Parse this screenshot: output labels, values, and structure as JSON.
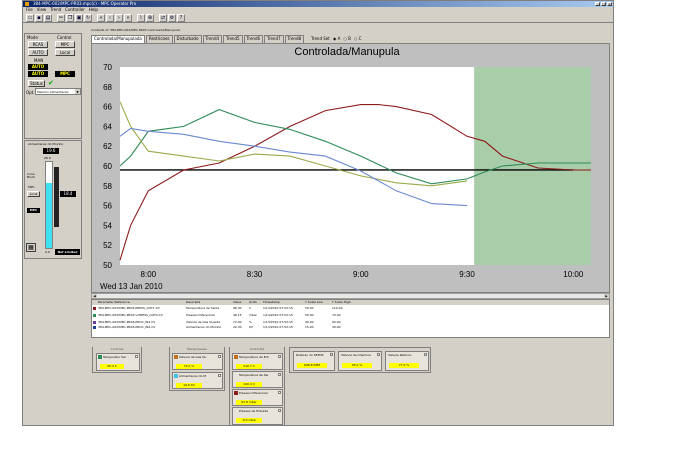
{
  "window": {
    "title": "384-MPC-002/MPC-PR03.mpc(c) - MPC Operator Pro"
  },
  "menu": [
    "File",
    "View",
    "Trend",
    "Controller",
    "Help"
  ],
  "toolbar": {
    "icons": [
      "open-icon",
      "save-icon",
      "print-icon",
      "cut-icon",
      "copy-icon",
      "paste-icon",
      "refresh-icon",
      "first-icon",
      "prev-icon",
      "next-icon",
      "last-icon",
      "trend-icon",
      "zoom-icon",
      "connect-icon",
      "gear-icon",
      "help-icon"
    ]
  },
  "left": {
    "mode_label": "Mode",
    "control_label": "Control",
    "rcas": "RCAS",
    "auto": "AUTO",
    "man": "MAN",
    "mpc_btn": "MPC",
    "local_btn": "Local",
    "mode_state1": "AUTO",
    "mode_state2": "AUTO",
    "mpc_state": "MPC",
    "status_label": "Status",
    "opt_label": "Opt.",
    "opt_value": "Maximo Alimentacao",
    "feed_title": "Alimentacao do Moinho",
    "feed_value": "19.6",
    "scale_top": "28.0",
    "scale_bottom": "0.0",
    "bar_value": "18.4",
    "cons_block": "Cons. Block",
    "mpc_small": "MPC",
    "local_small": "Local",
    "mpc_state2": "MPC",
    "not_limited": "Not Limited"
  },
  "main": {
    "path": "Contents of '384-MPC-002/MPC-PR03 Controlada/Manupula'",
    "tabs": [
      "Controlada/Manupulada",
      "Restricoes",
      "Disturbado",
      "Trend4",
      "Trend5",
      "Trend6",
      "Trend7",
      "Trend8"
    ],
    "trendset_label": "Trend Set",
    "trendset_options": [
      "A",
      "B",
      "C"
    ]
  },
  "chart_data": {
    "type": "line",
    "title": "Controlada/Manupula",
    "date_label": "Wed 13 Jan 2010",
    "x_ticks": [
      "8:00",
      "8:30",
      "9:00",
      "9:30",
      "10:00"
    ],
    "y_ticks": [
      50,
      52,
      54,
      56,
      58,
      60,
      62,
      64,
      66,
      68,
      70
    ],
    "ylim": [
      50,
      70
    ],
    "xlim_minutes": [
      -8,
      125
    ],
    "future_start_minutes": 92,
    "setpoint": 59.6,
    "series": [
      {
        "color": "#8b1a1a",
        "x": [
          -8,
          -5,
          0,
          10,
          20,
          30,
          40,
          50,
          60,
          65,
          70,
          80,
          90,
          95,
          100,
          110,
          120,
          125
        ],
        "values": [
          50.5,
          54,
          57.5,
          59.6,
          60.3,
          62,
          64,
          65.6,
          66.2,
          66.2,
          66,
          65.2,
          63,
          62.5,
          61,
          59.8,
          59.6,
          59.6
        ]
      },
      {
        "color": "#2e8b57",
        "x": [
          -8,
          -5,
          0,
          10,
          20,
          30,
          40,
          50,
          60,
          70,
          80,
          90,
          95,
          100,
          110,
          120,
          125
        ],
        "values": [
          60,
          61,
          63.5,
          64,
          65.7,
          64.4,
          63.7,
          62.5,
          61,
          59.3,
          58.2,
          58.7,
          59.4,
          60,
          60.3,
          60.3,
          60.3
        ]
      },
      {
        "color": "#9aab4a",
        "x": [
          -8,
          -5,
          0,
          10,
          20,
          30,
          40,
          50,
          60,
          70,
          80,
          90
        ],
        "values": [
          66.5,
          64,
          61.5,
          61,
          60.5,
          61.2,
          61,
          60,
          59,
          58.3,
          58,
          58.5
        ]
      },
      {
        "color": "#6a8ad0",
        "x": [
          -8,
          -5,
          0,
          10,
          20,
          30,
          40,
          50,
          60,
          70,
          80,
          90
        ],
        "values": [
          63,
          63.8,
          63.5,
          63.2,
          62.5,
          62,
          61.4,
          61,
          59.5,
          57.5,
          56.2,
          56
        ]
      }
    ]
  },
  "table": {
    "headers": [
      "Parameter Reference",
      "Descripta",
      "Value",
      "Units",
      "Timestamp",
      "Y Scale Low",
      "Y Scale High"
    ],
    "rows": [
      {
        "color": "#8b1a1a",
        "ref": "384-MPC-002/MPC-PR03.PRESS_OUT1.CV",
        "desc": "Temperatura de Saida",
        "value": "96.30",
        "units": "C",
        "time": "1/13/2010 07:52:15",
        "low": "50.00",
        "high": "110.00"
      },
      {
        "color": "#2e8b57",
        "ref": "384-MPC-002/MPC-PR03.V-PRESS_OUT4.CV",
        "desc": "Pressao Diferencial",
        "value": "48.15",
        "units": "mbar",
        "time": "1/13/2010 07:52:15",
        "low": "50.00",
        "high": "70.00"
      },
      {
        "color": "#6a3d9a",
        "ref": "384-MPC-002/MPC-PR03.PROC_IN1.CV",
        "desc": "Valvula de Gas Quente",
        "value": "72.00",
        "units": "%",
        "time": "1/13/2010 07:52:15",
        "low": "40.00",
        "high": "90.00"
      },
      {
        "color": "#1f3a93",
        "ref": "384-MPC-002/MPC-PR03.PROC_IN2.CV",
        "desc": "Alimentacao do Moinho",
        "value": "20.30",
        "units": "t/h",
        "time": "1/13/2010 07:52:15",
        "low": "15.00",
        "high": "30.00"
      }
    ]
  },
  "groups": {
    "g1_title": "Controle",
    "g2_title": "Manipulaveis",
    "g3_title": "Controlad",
    "g1_card": {
      "title": "Temperatur Sai",
      "value": "95.4 C"
    },
    "g2_cards": [
      {
        "title": "Valvula de Gas Qu",
        "value": "72.0 %"
      },
      {
        "title": "Alimentacao do M",
        "value": "19.6 t/h"
      }
    ],
    "g3_cards": [
      {
        "title": "Temperatura de Ent",
        "value": "210.7 C"
      },
      {
        "title": "Temperatura de Sai",
        "value": "100.4 C"
      },
      {
        "title": "Pressao Diferencial",
        "value": "63.8 mbar"
      },
      {
        "title": "Pressao de Entrada",
        "value": "-8.0 mbar"
      }
    ],
    "g4_cards": [
      {
        "title": "Rotacao do SEPOX",
        "value": "608.8 RPM"
      },
      {
        "title": "Valvula de Chamine",
        "value": "45.0 %"
      },
      {
        "title": "Valvula Retorno",
        "value": "77.0 %"
      }
    ]
  }
}
